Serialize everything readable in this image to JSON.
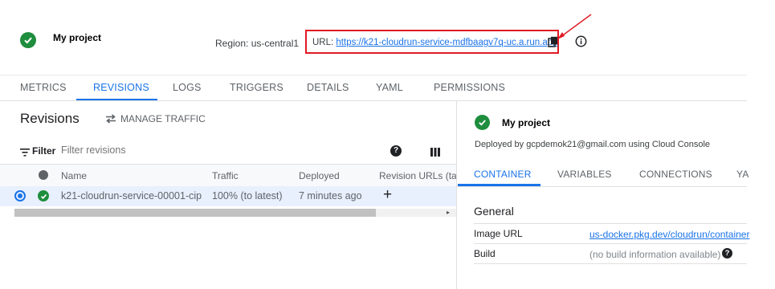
{
  "header": {
    "project_name": "My project",
    "region_label": "Region: us-central1",
    "url_prefix": "URL:",
    "url": "https://k21-cloudrun-service-mdfbaagv7q-uc.a.run.app",
    "copy_icon": "copy-icon",
    "info_icon": "info-icon",
    "highlight_color": "#e01b24"
  },
  "tabs": [
    {
      "label": "METRICS"
    },
    {
      "label": "REVISIONS"
    },
    {
      "label": "LOGS"
    },
    {
      "label": "TRIGGERS"
    },
    {
      "label": "DETAILS"
    },
    {
      "label": "YAML"
    },
    {
      "label": "PERMISSIONS"
    }
  ],
  "revisions": {
    "title": "Revisions",
    "manage_traffic": "MANAGE TRAFFIC",
    "filter_label": "Filter",
    "filter_placeholder": "Filter revisions",
    "columns": [
      "Name",
      "Traffic",
      "Deployed",
      "Revision URLs (tags"
    ],
    "rows": [
      {
        "name": "k21-cloudrun-service-00001-cip",
        "traffic": "100% (to latest)",
        "deployed": "7 minutes ago",
        "add": "+"
      }
    ]
  },
  "details": {
    "project_name": "My project",
    "deployed_by": "Deployed by gcpdemok21@gmail.com using Cloud Console",
    "tabs": [
      {
        "label": "CONTAINER"
      },
      {
        "label": "VARIABLES"
      },
      {
        "label": "CONNECTIONS"
      },
      {
        "label": "YA"
      }
    ],
    "section_title": "General",
    "fields": [
      {
        "label": "Image URL",
        "value": "us-docker.pkg.dev/cloudrun/container"
      },
      {
        "label": "Build",
        "value": "(no build information available)"
      }
    ]
  },
  "colors": {
    "accent": "#1a73e8",
    "success": "#1e8e3e"
  }
}
